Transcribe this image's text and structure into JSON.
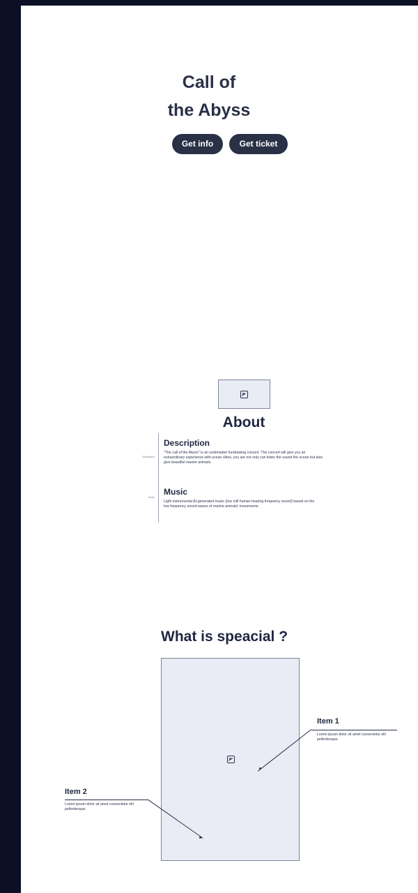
{
  "hero": {
    "title_line1": "Call of",
    "title_line2": "the Abyss",
    "buttons": {
      "info": "Get info",
      "ticket": "Get ticket"
    }
  },
  "about": {
    "title": "About",
    "icon": "image-placeholder-icon",
    "description": {
      "side_label": "Description",
      "title": "Description",
      "text": "\"The call of the Abyss\" is an underwater fundraising concert. The concert will give you an extraordinary experience with ocean vibes, you are not only can listen the sound the ocean but also give beautiful marine animals."
    },
    "music": {
      "side_label": "Music",
      "title": "Music",
      "text": "Light instrumental AI-generated music (low mill human hearing frequency sound) based on the low frequency sound waves of marine animals' movements."
    }
  },
  "special": {
    "title": "What is speacial ?",
    "icon": "image-placeholder-icon",
    "items": [
      {
        "title": "Item 1",
        "text": "Lorem ipsum dolor sit amet consectetur elit pellentesque."
      },
      {
        "title": "Item 2",
        "text": "Lorem ipsum dolor sit amet consectetur elit pellentesque."
      }
    ]
  },
  "colors": {
    "sidebar": "#0b1026",
    "primary": "#2a3046",
    "placeholder": "#e9ecf5"
  }
}
